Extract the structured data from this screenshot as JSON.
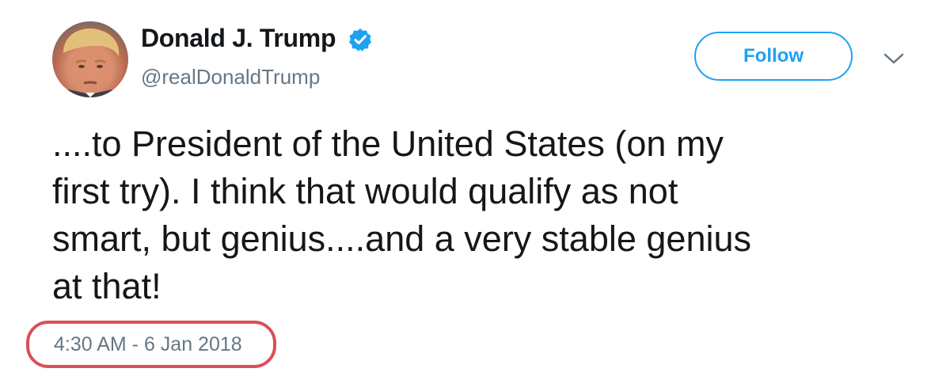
{
  "user": {
    "display_name": "Donald J. Trump",
    "handle": "@realDonaldTrump",
    "verified": true
  },
  "follow_button": {
    "label": "Follow"
  },
  "tweet": {
    "lines": [
      "....to President of the United States (on my",
      "first try). I think that would qualify as not",
      "smart, but genius....and a very stable genius",
      "at that!"
    ],
    "timestamp": "4:30 AM - 6 Jan 2018"
  },
  "colors": {
    "brand_blue": "#1da1f2",
    "text_primary": "#14171a",
    "text_secondary": "#657786",
    "highlight_red": "#d9505a"
  },
  "icons": {
    "verified": "verified-badge-icon",
    "menu": "chevron-down-icon"
  }
}
